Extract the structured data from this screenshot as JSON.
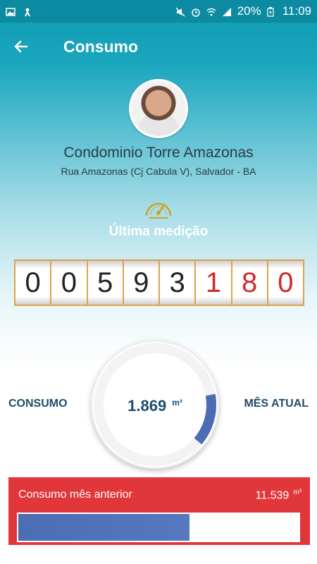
{
  "statusbar": {
    "battery": "20%",
    "time": "11:09"
  },
  "appbar": {
    "back_icon": "arrow-left-icon",
    "title": "Consumo"
  },
  "condo": {
    "name": "Condominio Torre Amazonas",
    "address": "Rua Amazonas (Cj Cabula V), Salvador - BA"
  },
  "last_reading": {
    "label": "Última medição",
    "digits": [
      "0",
      "0",
      "5",
      "9",
      "3",
      "1",
      "8",
      "0"
    ],
    "red_digit_count": 3
  },
  "consumption": {
    "left_label": "CONSUMO",
    "right_label": "MÊS ATUAL",
    "value": "1.869",
    "unit": "m³",
    "dial_fraction": 0.14
  },
  "previous": {
    "label": "Consumo mês anterior",
    "value": "11.539",
    "unit": "m³",
    "bar_fraction": 0.61
  },
  "colors": {
    "accent": "#0f9ab3",
    "title_blue": "#1f4c6b",
    "red": "#e2373a",
    "bar_blue": "#4b6db3",
    "odometer_border": "#d9a54a"
  }
}
